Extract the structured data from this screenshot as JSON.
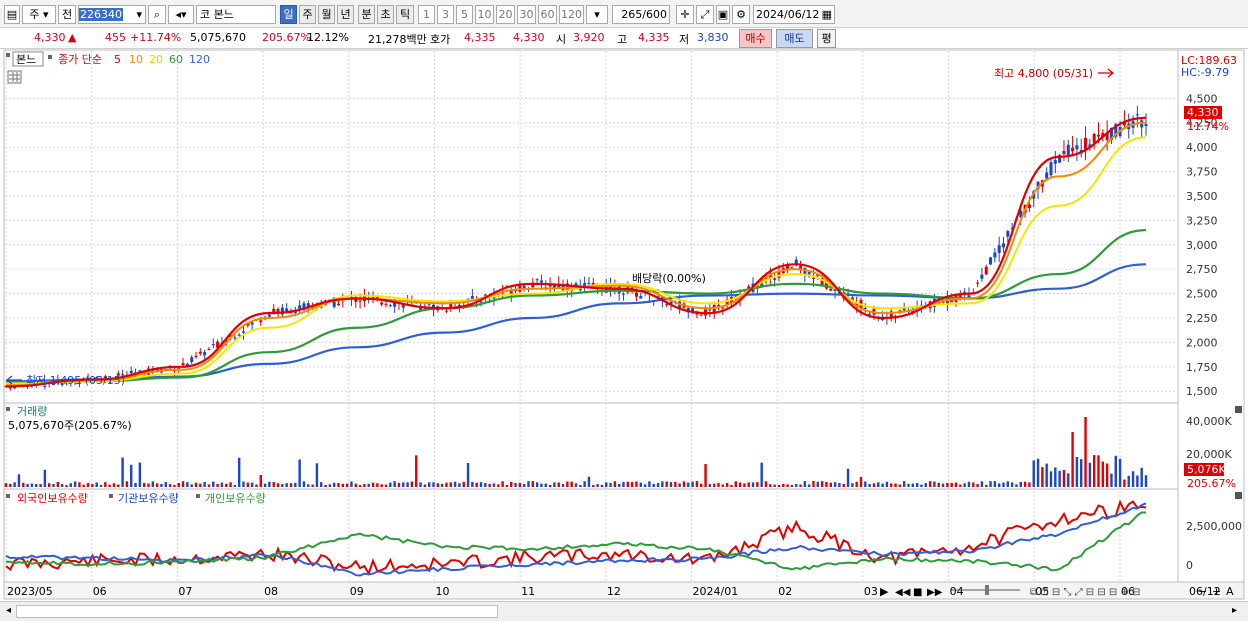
{
  "toolbar": {
    "market": "주",
    "prev": "전",
    "code": "226340",
    "market2": "코",
    "name": "본느",
    "periods": [
      "일",
      "주",
      "월",
      "년",
      "분",
      "초",
      "틱"
    ],
    "intervals": [
      "1",
      "3",
      "5",
      "10",
      "20",
      "30",
      "60",
      "120"
    ],
    "count": "265",
    "count_total": "/600",
    "date": "2024/06/12"
  },
  "info": {
    "price": "4,330",
    "arrow": "▲",
    "change": "455",
    "change_pct": "+11.74%",
    "volume": "5,075,670",
    "vol_ratio": "205.67%",
    "turnover": "12.12%",
    "amount": "21,278백만",
    "bid_label": "호가",
    "bid1": "4,335",
    "bid2": "4,330",
    "open_label": "시",
    "open": "3,920",
    "high_label": "고",
    "high": "4,335",
    "low_label": "저",
    "low": "3,830",
    "buy": "매수",
    "sell": "매도",
    "eval": "평"
  },
  "price_panel": {
    "tag": "본느",
    "legend_prefix": "종가 단순",
    "ma_labels": [
      "5",
      "10",
      "20",
      "60",
      "120"
    ],
    "high_note": "최고 4,800 (05/31)",
    "low_note": "최저 1,495 (05/15)",
    "dividend_note": "배당락(0.00%)",
    "lc": "LC:189.63",
    "hc": "HC:-9.79",
    "cur_price": "4,330",
    "cur_pct": "11.74%",
    "y_ticks": [
      "4,500",
      "4,250",
      "4,000",
      "3,750",
      "3,500",
      "3,250",
      "3,000",
      "2,750",
      "2,500",
      "2,250",
      "2,000",
      "1,750",
      "1,500"
    ]
  },
  "volume_panel": {
    "title": "거래량",
    "value": "5,075,670주(205.67%)",
    "y_ticks": [
      "40,000K",
      "20,000K"
    ],
    "cur_vol": "5,076K",
    "cur_pct": "205.67%"
  },
  "holdings_panel": {
    "legend": [
      "외국인보유수량",
      "기관보유수량",
      "개인보유수량"
    ],
    "y_ticks": [
      "2,500,000",
      "0"
    ]
  },
  "x_axis": {
    "labels": [
      "2023/05",
      "06",
      "07",
      "08",
      "09",
      "10",
      "11",
      "12",
      "2024/01",
      "02",
      "03",
      "04",
      "05",
      "06",
      "06/12"
    ]
  },
  "colors": {
    "ma5": "#e00000",
    "ma10": "#f08a00",
    "ma20": "#f5e600",
    "ma60": "#2e9b3a",
    "ma120": "#2f5fd4",
    "up": "#e00000",
    "down": "#1a46c7"
  },
  "chart_data": {
    "type": "line",
    "title": "",
    "xlabel": "",
    "ylabel": "",
    "ylim": [
      1400,
      4800
    ],
    "x": [
      "2023/05",
      "06",
      "07",
      "08",
      "09",
      "10",
      "11",
      "12",
      "2024/01",
      "02",
      "03",
      "04",
      "05",
      "06"
    ],
    "series": [
      {
        "name": "5",
        "values": [
          1550,
          1620,
          1750,
          2300,
          2450,
          2350,
          2600,
          2550,
          2300,
          2800,
          2250,
          2500,
          3900,
          4300
        ]
      },
      {
        "name": "10",
        "values": [
          1560,
          1610,
          1720,
          2250,
          2450,
          2400,
          2550,
          2580,
          2350,
          2750,
          2300,
          2450,
          3700,
          4250
        ]
      },
      {
        "name": "20",
        "values": [
          1580,
          1600,
          1680,
          2150,
          2480,
          2420,
          2500,
          2600,
          2400,
          2700,
          2350,
          2400,
          3400,
          4100
        ]
      },
      {
        "name": "60",
        "values": [
          1590,
          1600,
          1640,
          1900,
          2150,
          2350,
          2480,
          2530,
          2500,
          2600,
          2500,
          2450,
          2700,
          3150
        ]
      },
      {
        "name": "120",
        "values": [
          1600,
          1620,
          1650,
          1780,
          1950,
          2100,
          2250,
          2400,
          2480,
          2500,
          2480,
          2450,
          2550,
          2800
        ]
      }
    ]
  }
}
